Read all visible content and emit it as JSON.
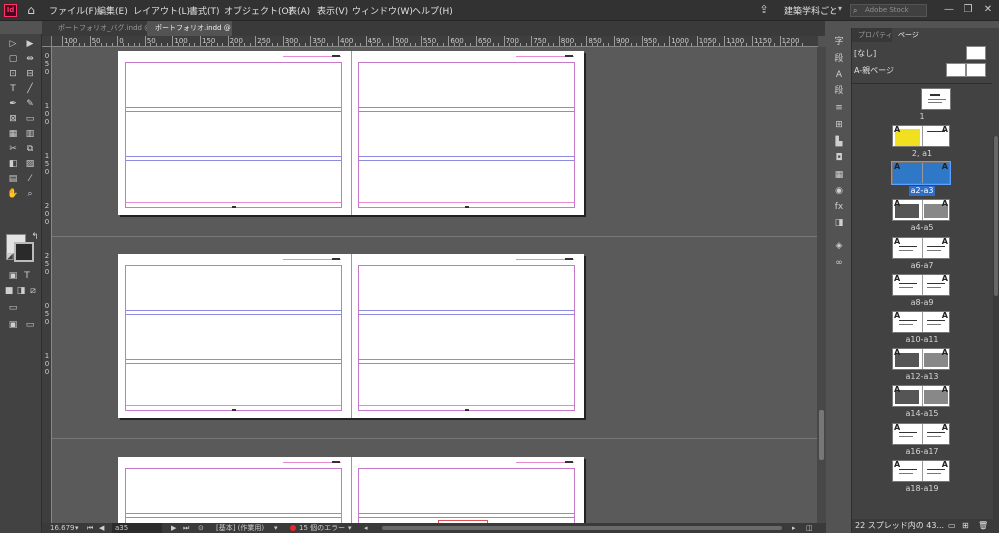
{
  "menu": {
    "items": [
      "ファイル(F)",
      "編集(E)",
      "レイアウト(L)",
      "書式(T)",
      "オブジェクト(O)",
      "表(A)",
      "表示(V)",
      "ウィンドウ(W)",
      "ヘルプ(H)"
    ],
    "workspace": "建築学科ごと",
    "search_placeholder": "Adobe Stock",
    "app_logo": "Id"
  },
  "tabs": [
    {
      "label": "ポートフォリオ_バグ.indd @ 8%",
      "close": "×",
      "active": false
    },
    {
      "label": "ポートフォリオ.indd @ 25%",
      "close": "×",
      "active": true
    }
  ],
  "ruler": {
    "h_labels": [
      "100",
      "50",
      "0",
      "50",
      "100",
      "150",
      "200",
      "250",
      "300",
      "350",
      "400",
      "450",
      "500",
      "550",
      "600",
      "650",
      "700",
      "750",
      "800",
      "850",
      "900",
      "950",
      "1000",
      "1050",
      "1100",
      "1150",
      "1200"
    ],
    "v_labels": [
      "0",
      "5",
      "0",
      "1",
      "0",
      "0",
      "1",
      "5",
      "0",
      "2",
      "0",
      "0",
      "2",
      "5",
      "0",
      "0",
      "5",
      "0",
      "1",
      "0",
      "0"
    ]
  },
  "status": {
    "zoom": "16.679",
    "page": "a35",
    "preflight": "[基本] (作業用)",
    "errors": "15 個のエラー"
  },
  "panel": {
    "tab_properties": "プロパティ",
    "tab_pages": "ページ",
    "master_none": "[なし]",
    "master_a": "A-親ページ",
    "pages": [
      {
        "label": "1",
        "selected": false
      },
      {
        "label": "2, a1",
        "selected": false
      },
      {
        "label": "a2-a3",
        "selected": true
      },
      {
        "label": "a4-a5",
        "selected": false
      },
      {
        "label": "a6-a7",
        "selected": false
      },
      {
        "label": "a8-a9",
        "selected": false
      },
      {
        "label": "a10-a11",
        "selected": false
      },
      {
        "label": "a12-a13",
        "selected": false
      },
      {
        "label": "a14-a15",
        "selected": false
      },
      {
        "label": "a16-a17",
        "selected": false
      },
      {
        "label": "a18-a19",
        "selected": false
      }
    ],
    "status_text": "22 スプレッド内の 43..."
  },
  "colors": {
    "accent": "#2f6ec6",
    "error": "#e8262b",
    "margin": "#c779c9"
  }
}
